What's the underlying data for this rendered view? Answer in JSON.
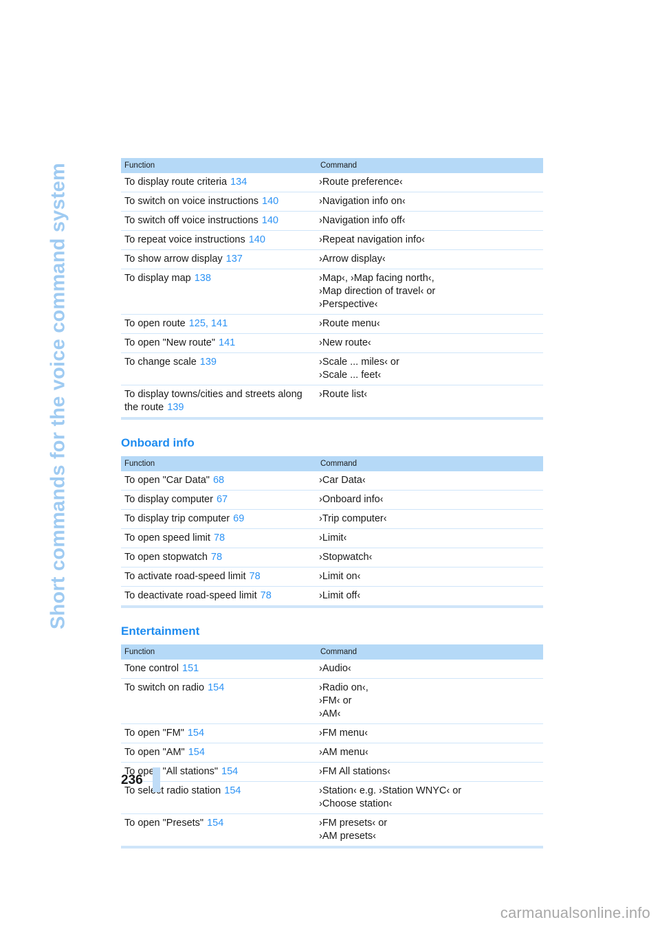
{
  "side_tab": {
    "title": "Short commands for the voice command system"
  },
  "table_headers": {
    "function": "Function",
    "command": "Command"
  },
  "sections": [
    {
      "heading": null,
      "rows": [
        {
          "function": "To display route criteria",
          "pages": "134",
          "command": "›Route preference‹"
        },
        {
          "function": "To switch on voice instructions",
          "pages": "140",
          "command": "›Navigation info on‹"
        },
        {
          "function": "To switch off voice instructions",
          "pages": "140",
          "command": "›Navigation info off‹"
        },
        {
          "function": "To repeat voice instructions",
          "pages": "140",
          "command": "›Repeat navigation info‹"
        },
        {
          "function": "To show arrow display",
          "pages": "137",
          "command": "›Arrow display‹"
        },
        {
          "function": "To display map",
          "pages": "138",
          "command": "›Map‹, ›Map facing north‹,\n›Map direction of travel‹ or\n›Perspective‹"
        },
        {
          "function": "To open route",
          "pages": "125, 141",
          "command": "›Route menu‹"
        },
        {
          "function": "To open \"New route\"",
          "pages": "141",
          "command": "›New route‹"
        },
        {
          "function": "To change scale",
          "pages": "139",
          "command": "›Scale ... miles‹ or\n›Scale ... feet‹"
        },
        {
          "function": "To display towns/cities and streets along the route",
          "pages": "139",
          "command": "›Route list‹"
        }
      ]
    },
    {
      "heading": "Onboard info",
      "rows": [
        {
          "function": "To open \"Car Data\"",
          "pages": "68",
          "command": "›Car Data‹"
        },
        {
          "function": "To display computer",
          "pages": "67",
          "command": "›Onboard info‹"
        },
        {
          "function": "To display trip computer",
          "pages": "69",
          "command": "›Trip computer‹"
        },
        {
          "function": "To open speed limit",
          "pages": "78",
          "command": "›Limit‹"
        },
        {
          "function": "To open stopwatch",
          "pages": "78",
          "command": "›Stopwatch‹"
        },
        {
          "function": "To activate road-speed limit",
          "pages": "78",
          "command": "›Limit on‹"
        },
        {
          "function": "To deactivate road-speed limit",
          "pages": "78",
          "command": "›Limit off‹"
        }
      ]
    },
    {
      "heading": "Entertainment",
      "rows": [
        {
          "function": "Tone control",
          "pages": "151",
          "command": "›Audio‹"
        },
        {
          "function": "To switch on radio",
          "pages": "154",
          "command": "›Radio on‹,\n›FM‹ or\n›AM‹"
        },
        {
          "function": "To open \"FM\"",
          "pages": "154",
          "command": "›FM menu‹"
        },
        {
          "function": "To open \"AM\"",
          "pages": "154",
          "command": "›AM menu‹"
        },
        {
          "function": "To open \"All stations\"",
          "pages": "154",
          "command": "›FM All stations‹"
        },
        {
          "function": "To select radio station",
          "pages": "154",
          "command": "›Station‹ e.g. ›Station WNYC‹ or\n›Choose station‹"
        },
        {
          "function": "To open \"Presets\"",
          "pages": "154",
          "command": "›FM presets‹ or\n›AM presets‹"
        }
      ]
    }
  ],
  "footer": {
    "page_number": "236"
  },
  "watermark": {
    "text": "carmanualsonline.info"
  },
  "colors": {
    "header_bg": "#b5d9f7",
    "row_rule": "#cfe5f9",
    "heading_blue": "#1e8cf0",
    "page_ref_blue": "#2d93f5",
    "side_tab_blue": "#9fcbf2"
  }
}
